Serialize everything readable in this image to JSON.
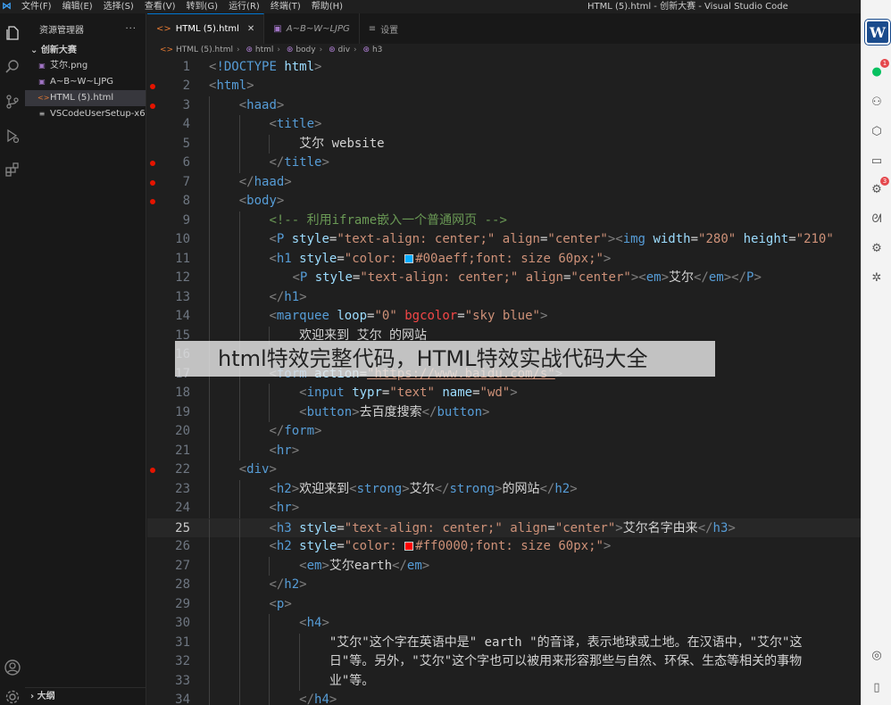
{
  "window": {
    "title": "HTML (5).html - 创新大赛 - Visual Studio Code"
  },
  "menu": [
    "文件(F)",
    "编辑(E)",
    "选择(S)",
    "查看(V)",
    "转到(G)",
    "运行(R)",
    "终端(T)",
    "帮助(H)"
  ],
  "activity_bar": [
    "explorer-icon",
    "search-icon",
    "source-control-icon",
    "run-debug-icon",
    "extensions-icon",
    "account-icon",
    "manage-gear-icon"
  ],
  "sidebar": {
    "title": "资源管理器",
    "more": "···",
    "project": "创新大赛",
    "files": [
      {
        "name": "艾尔.png",
        "icon": "image-file-icon",
        "active": false
      },
      {
        "name": "A~B~W~LJPG",
        "icon": "image-file-icon",
        "active": false
      },
      {
        "name": "HTML (5).html",
        "icon": "html-file-icon",
        "active": true
      },
      {
        "name": "VSCodeUserSetup-x6...",
        "icon": "exe-file-icon",
        "active": false
      }
    ],
    "outline": "大纲"
  },
  "tabs": [
    {
      "label": "HTML (5).html",
      "icon": "html-file-icon",
      "active": true,
      "close": "✕"
    },
    {
      "label": "A~B~W~LJPG",
      "icon": "image-file-icon",
      "active": false
    },
    {
      "label": "设置",
      "icon": "settings-icon",
      "active": false
    }
  ],
  "breadcrumb": [
    "HTML (5).html",
    "html",
    "body",
    "div",
    "h3"
  ],
  "editor": {
    "current_line": 25,
    "breakpoint_lines": [
      2,
      3,
      6,
      7,
      8,
      22
    ],
    "lines": [
      {
        "n": "1",
        "indent": 0,
        "tokens": [
          [
            "br",
            "<"
          ],
          [
            "doct",
            "!DOCTYPE"
          ],
          [
            "text",
            " "
          ],
          [
            "attr",
            "html"
          ],
          [
            "br",
            ">"
          ]
        ]
      },
      {
        "n": "2",
        "indent": 0,
        "tokens": [
          [
            "br",
            "<"
          ],
          [
            "tag",
            "html"
          ],
          [
            "br",
            ">"
          ]
        ]
      },
      {
        "n": "3",
        "indent": 1,
        "tokens": [
          [
            "br",
            "<"
          ],
          [
            "tag",
            "haad"
          ],
          [
            "br",
            ">"
          ]
        ]
      },
      {
        "n": "4",
        "indent": 2,
        "tokens": [
          [
            "br",
            "<"
          ],
          [
            "tag",
            "title"
          ],
          [
            "br",
            ">"
          ]
        ]
      },
      {
        "n": "5",
        "indent": 3,
        "tokens": [
          [
            "text",
            "艾尔 website"
          ]
        ]
      },
      {
        "n": "6",
        "indent": 2,
        "tokens": [
          [
            "br",
            "</"
          ],
          [
            "tag",
            "title"
          ],
          [
            "br",
            ">"
          ]
        ]
      },
      {
        "n": "7",
        "indent": 1,
        "tokens": [
          [
            "br",
            "</"
          ],
          [
            "tag",
            "haad"
          ],
          [
            "br",
            ">"
          ]
        ]
      },
      {
        "n": "8",
        "indent": 1,
        "tokens": [
          [
            "br",
            "<"
          ],
          [
            "tag",
            "body"
          ],
          [
            "br",
            ">"
          ]
        ]
      },
      {
        "n": "9",
        "indent": 2,
        "tokens": [
          [
            "com",
            "<!-- 利用iframe嵌入一个普通网页 -->"
          ]
        ]
      },
      {
        "n": "10",
        "indent": 2,
        "tokens": [
          [
            "br",
            "<"
          ],
          [
            "tag",
            "P"
          ],
          [
            "text",
            " "
          ],
          [
            "attr",
            "style"
          ],
          [
            "text",
            "="
          ],
          [
            "str",
            "\"text-align: center;\""
          ],
          [
            "text",
            " "
          ],
          [
            "attr2",
            "align"
          ],
          [
            "text",
            "="
          ],
          [
            "str",
            "\"center\""
          ],
          [
            "br",
            ">"
          ],
          [
            "br",
            "<"
          ],
          [
            "tag",
            "img"
          ],
          [
            "text",
            " "
          ],
          [
            "attr",
            "width"
          ],
          [
            "text",
            "="
          ],
          [
            "str",
            "\"280\""
          ],
          [
            "text",
            " "
          ],
          [
            "attr",
            "height"
          ],
          [
            "text",
            "="
          ],
          [
            "str",
            "\"210\""
          ]
        ]
      },
      {
        "n": "11",
        "indent": 2,
        "tokens": [
          [
            "br",
            "<"
          ],
          [
            "tag",
            "h1"
          ],
          [
            "text",
            " "
          ],
          [
            "attr",
            "style"
          ],
          [
            "text",
            "="
          ],
          [
            "str",
            "\"color: "
          ],
          [
            "swatch",
            "#00aeff"
          ],
          [
            "str",
            "#00aeff;font: size 60px;\""
          ],
          [
            "br",
            ">"
          ]
        ]
      },
      {
        "n": "12",
        "indent": 2,
        "extra": 26,
        "tokens": [
          [
            "br",
            "<"
          ],
          [
            "tag",
            "P"
          ],
          [
            "text",
            " "
          ],
          [
            "attr",
            "style"
          ],
          [
            "text",
            "="
          ],
          [
            "str",
            "\"text-align: center;\""
          ],
          [
            "text",
            " "
          ],
          [
            "attr2",
            "align"
          ],
          [
            "text",
            "="
          ],
          [
            "str",
            "\"center\""
          ],
          [
            "br",
            ">"
          ],
          [
            "br",
            "<"
          ],
          [
            "tag",
            "em"
          ],
          [
            "br",
            ">"
          ],
          [
            "text",
            "艾尔"
          ],
          [
            "br",
            "</"
          ],
          [
            "tag",
            "em"
          ],
          [
            "br",
            ">"
          ],
          [
            "br",
            "</"
          ],
          [
            "tag",
            "P"
          ],
          [
            "br",
            ">"
          ]
        ]
      },
      {
        "n": "13",
        "indent": 2,
        "tokens": [
          [
            "br",
            "</"
          ],
          [
            "tag",
            "h1"
          ],
          [
            "br",
            ">"
          ]
        ]
      },
      {
        "n": "14",
        "indent": 2,
        "tokens": [
          [
            "br",
            "<"
          ],
          [
            "tag",
            "marquee"
          ],
          [
            "text",
            " "
          ],
          [
            "attr",
            "loop"
          ],
          [
            "text",
            "="
          ],
          [
            "str",
            "\"0\""
          ],
          [
            "text",
            " "
          ],
          [
            "err",
            "bgcolor"
          ],
          [
            "text",
            "="
          ],
          [
            "str",
            "\"sky blue\""
          ],
          [
            "br",
            ">"
          ]
        ]
      },
      {
        "n": "15",
        "indent": 3,
        "tokens": [
          [
            "text",
            "欢迎来到 艾尔 的网站"
          ]
        ]
      },
      {
        "n": "16",
        "indent": 2,
        "tokens": []
      },
      {
        "n": "17",
        "indent": 2,
        "tokens": [
          [
            "br",
            "<"
          ],
          [
            "tag",
            "form"
          ],
          [
            "text",
            " "
          ],
          [
            "attr",
            "action"
          ],
          [
            "text",
            "="
          ],
          [
            "link",
            "\"https://www.baidu.com/s\""
          ],
          [
            "br",
            ">"
          ]
        ]
      },
      {
        "n": "18",
        "indent": 3,
        "tokens": [
          [
            "br",
            "<"
          ],
          [
            "tag",
            "input"
          ],
          [
            "text",
            " "
          ],
          [
            "attr",
            "typr"
          ],
          [
            "text",
            "="
          ],
          [
            "str",
            "\"text\""
          ],
          [
            "text",
            " "
          ],
          [
            "attr",
            "name"
          ],
          [
            "text",
            "="
          ],
          [
            "str",
            "\"wd\""
          ],
          [
            "br",
            ">"
          ]
        ]
      },
      {
        "n": "19",
        "indent": 3,
        "tokens": [
          [
            "br",
            "<"
          ],
          [
            "tag",
            "button"
          ],
          [
            "br",
            ">"
          ],
          [
            "text",
            "去百度搜索"
          ],
          [
            "br",
            "</"
          ],
          [
            "tag",
            "button"
          ],
          [
            "br",
            ">"
          ]
        ]
      },
      {
        "n": "20",
        "indent": 2,
        "tokens": [
          [
            "br",
            "</"
          ],
          [
            "tag",
            "form"
          ],
          [
            "br",
            ">"
          ]
        ]
      },
      {
        "n": "21",
        "indent": 2,
        "tokens": [
          [
            "br",
            "<"
          ],
          [
            "tag",
            "hr"
          ],
          [
            "br",
            ">"
          ]
        ]
      },
      {
        "n": "22",
        "indent": 1,
        "tokens": [
          [
            "br",
            "<"
          ],
          [
            "tag",
            "div"
          ],
          [
            "br",
            ">"
          ]
        ]
      },
      {
        "n": "23",
        "indent": 2,
        "tokens": [
          [
            "br",
            "<"
          ],
          [
            "tag",
            "h2"
          ],
          [
            "br",
            ">"
          ],
          [
            "text",
            "欢迎来到"
          ],
          [
            "br",
            "<"
          ],
          [
            "tag",
            "strong"
          ],
          [
            "br",
            ">"
          ],
          [
            "text",
            "艾尔"
          ],
          [
            "br",
            "</"
          ],
          [
            "tag",
            "strong"
          ],
          [
            "br",
            ">"
          ],
          [
            "text",
            "的网站"
          ],
          [
            "br",
            "</"
          ],
          [
            "tag",
            "h2"
          ],
          [
            "br",
            ">"
          ]
        ]
      },
      {
        "n": "24",
        "indent": 2,
        "tokens": [
          [
            "br",
            "<"
          ],
          [
            "tag",
            "hr"
          ],
          [
            "br",
            ">"
          ]
        ]
      },
      {
        "n": "25",
        "indent": 2,
        "tokens": [
          [
            "br",
            "<"
          ],
          [
            "tag",
            "h3"
          ],
          [
            "text",
            " "
          ],
          [
            "attr",
            "style"
          ],
          [
            "text",
            "="
          ],
          [
            "str",
            "\"text-align: center;\""
          ],
          [
            "text",
            " "
          ],
          [
            "attr2",
            "align"
          ],
          [
            "text",
            "="
          ],
          [
            "str",
            "\"center\""
          ],
          [
            "br",
            ">"
          ],
          [
            "text",
            "艾尔名字由来"
          ],
          [
            "br",
            "</"
          ],
          [
            "tag",
            "h3"
          ],
          [
            "br",
            ">"
          ]
        ]
      },
      {
        "n": "26",
        "indent": 2,
        "tokens": [
          [
            "br",
            "<"
          ],
          [
            "tag",
            "h2"
          ],
          [
            "text",
            " "
          ],
          [
            "attr",
            "style"
          ],
          [
            "text",
            "="
          ],
          [
            "str",
            "\"color: "
          ],
          [
            "swatch",
            "#ff0000"
          ],
          [
            "str",
            "#ff0000;font: size 60px;\""
          ],
          [
            "br",
            ">"
          ]
        ]
      },
      {
        "n": "27",
        "indent": 3,
        "tokens": [
          [
            "br",
            "<"
          ],
          [
            "tag",
            "em"
          ],
          [
            "br",
            ">"
          ],
          [
            "text",
            "艾尔earth"
          ],
          [
            "br",
            "</"
          ],
          [
            "tag",
            "em"
          ],
          [
            "br",
            ">"
          ]
        ]
      },
      {
        "n": "28",
        "indent": 2,
        "tokens": [
          [
            "br",
            "</"
          ],
          [
            "tag",
            "h2"
          ],
          [
            "br",
            ">"
          ]
        ]
      },
      {
        "n": "29",
        "indent": 2,
        "tokens": [
          [
            "br",
            "<"
          ],
          [
            "tag",
            "p"
          ],
          [
            "br",
            ">"
          ]
        ]
      },
      {
        "n": "30",
        "indent": 3,
        "tokens": [
          [
            "br",
            "<"
          ],
          [
            "tag",
            "h4"
          ],
          [
            "br",
            ">"
          ]
        ]
      },
      {
        "n": "31",
        "indent": 4,
        "tokens": [
          [
            "text",
            "\"艾尔\"这个字在英语中是\" earth \"的音译，表示地球或土地。在汉语中，\"艾尔\"这"
          ]
        ]
      },
      {
        "n": "32",
        "indent": 4,
        "tokens": [
          [
            "text",
            "日\"等。另外，\"艾尔\"这个字也可以被用来形容那些与自然、环保、生态等相关的事物"
          ]
        ]
      },
      {
        "n": "33",
        "indent": 4,
        "tokens": [
          [
            "text",
            "业\"等。"
          ]
        ]
      },
      {
        "n": "34",
        "indent": 3,
        "tokens": [
          [
            "br",
            "</"
          ],
          [
            "tag",
            "h4"
          ],
          [
            "br",
            ">"
          ]
        ]
      }
    ]
  },
  "right_dock": {
    "avatar_letter": "W",
    "icons": [
      {
        "name": "wechat-icon",
        "glyph": "●",
        "badge": "1",
        "color": "#07c160"
      },
      {
        "name": "contacts-icon",
        "glyph": "⚇",
        "badge": ""
      },
      {
        "name": "cube-icon",
        "glyph": "⬡",
        "badge": ""
      },
      {
        "name": "folder-icon",
        "glyph": "▭",
        "badge": ""
      },
      {
        "name": "apps-icon",
        "glyph": "⚙",
        "badge": "3"
      },
      {
        "name": "butterfly-icon",
        "glyph": "ᘛ",
        "badge": ""
      },
      {
        "name": "settings-icon",
        "glyph": "⚙",
        "badge": ""
      },
      {
        "name": "sparkle-icon",
        "glyph": "✲",
        "badge": ""
      },
      {
        "name": "compass-icon",
        "glyph": "◎",
        "badge": ""
      },
      {
        "name": "phone-icon",
        "glyph": "▯",
        "badge": ""
      }
    ]
  },
  "caption": "html特效完整代码，HTML特效实战代码大全"
}
